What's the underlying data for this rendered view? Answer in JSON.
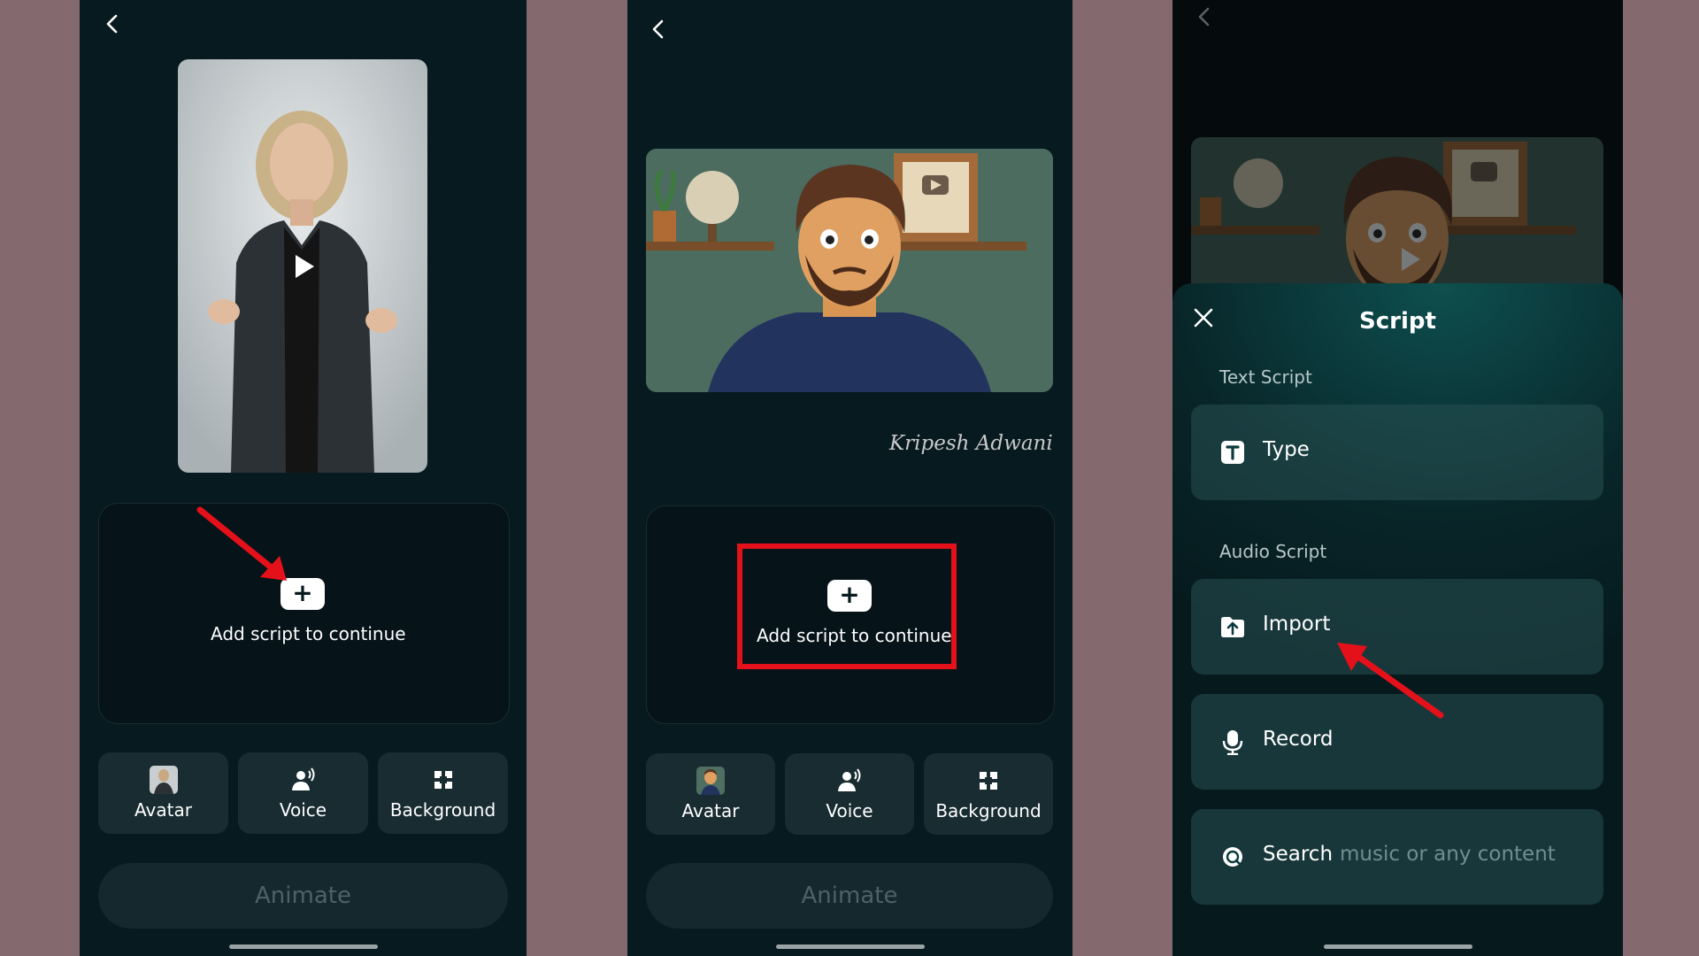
{
  "colors": {
    "page_bg": "#846a6f",
    "app_bg": "#071a1f",
    "highlight": "#e4111a",
    "accent_sheet": "#0e4f4e"
  },
  "panel1": {
    "add_script": "Add script to continue",
    "options": [
      {
        "label": "Avatar",
        "icon": "avatar-thumbnail-icon"
      },
      {
        "label": "Voice",
        "icon": "voice-icon"
      },
      {
        "label": "Background",
        "icon": "background-icon"
      }
    ],
    "animate": "Animate"
  },
  "panel2": {
    "signature": "Kripesh Adwani",
    "add_script": "Add script to continue",
    "options": [
      {
        "label": "Avatar",
        "icon": "avatar-thumbnail-icon"
      },
      {
        "label": "Voice",
        "icon": "voice-icon"
      },
      {
        "label": "Background",
        "icon": "background-icon"
      }
    ],
    "animate": "Animate"
  },
  "panel3": {
    "title": "Script",
    "text_script_label": "Text Script",
    "type_label": "Type",
    "audio_script_label": "Audio Script",
    "import_label": "Import",
    "record_label": "Record",
    "search_label": "Search",
    "search_placeholder": "music or any content"
  }
}
